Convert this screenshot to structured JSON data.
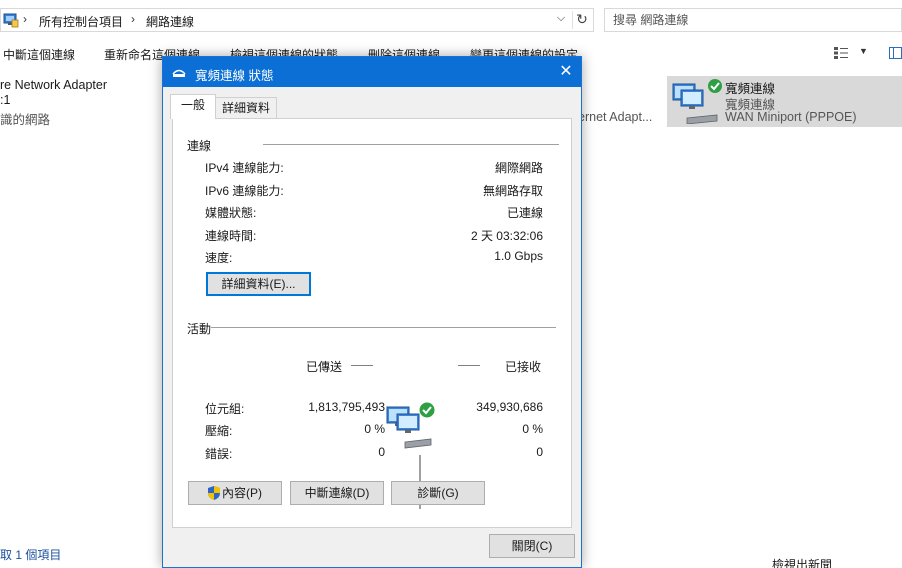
{
  "address_bar": {
    "breadcrumbs": [
      "所有控制台項目",
      "網路連線"
    ],
    "search_placeholder": "搜尋 網路連線"
  },
  "command_bar": {
    "items": [
      "中斷這個連線",
      "重新命名這個連線",
      "檢視這個連線的狀態",
      "刪除這個連線",
      "變更這個連線的設定"
    ]
  },
  "background_connections": {
    "left_lines": [
      "re Network Adapter",
      ":1",
      "識的網路"
    ],
    "middle_fragment": "ernet Adapt...",
    "selected": {
      "name": "寬頻連線",
      "status": "寬頻連線",
      "device": "WAN Miniport (PPPOE)"
    }
  },
  "status_bar": {
    "selection_text": "取 1 個項目",
    "bottom_right_fragment": "檢視出新聞"
  },
  "dialog": {
    "title": "寬頻連線 狀態",
    "tabs": [
      "一般",
      "詳細資料"
    ],
    "connection": {
      "section_title": "連線",
      "rows": [
        {
          "label": "IPv4 連線能力:",
          "value": "網際網路"
        },
        {
          "label": "IPv6 連線能力:",
          "value": "無網路存取"
        },
        {
          "label": "媒體狀態:",
          "value": "已連線"
        },
        {
          "label": "連線時間:",
          "value": "2 天 03:32:06"
        },
        {
          "label": "速度:",
          "value": "1.0 Gbps"
        }
      ],
      "details_button": "詳細資料(E)..."
    },
    "activity": {
      "section_title": "活動",
      "sent_label": "已傳送",
      "received_label": "已接收",
      "rows": [
        {
          "label": "位元組:",
          "sent": "1,813,795,493",
          "received": "349,930,686"
        },
        {
          "label": "壓縮:",
          "sent": "0 %",
          "received": "0 %"
        },
        {
          "label": "錯誤:",
          "sent": "0",
          "received": "0"
        }
      ]
    },
    "buttons": {
      "properties": "內容(P)",
      "disconnect": "中斷連線(D)",
      "diagnose": "診斷(G)",
      "close": "關閉(C)"
    }
  }
}
